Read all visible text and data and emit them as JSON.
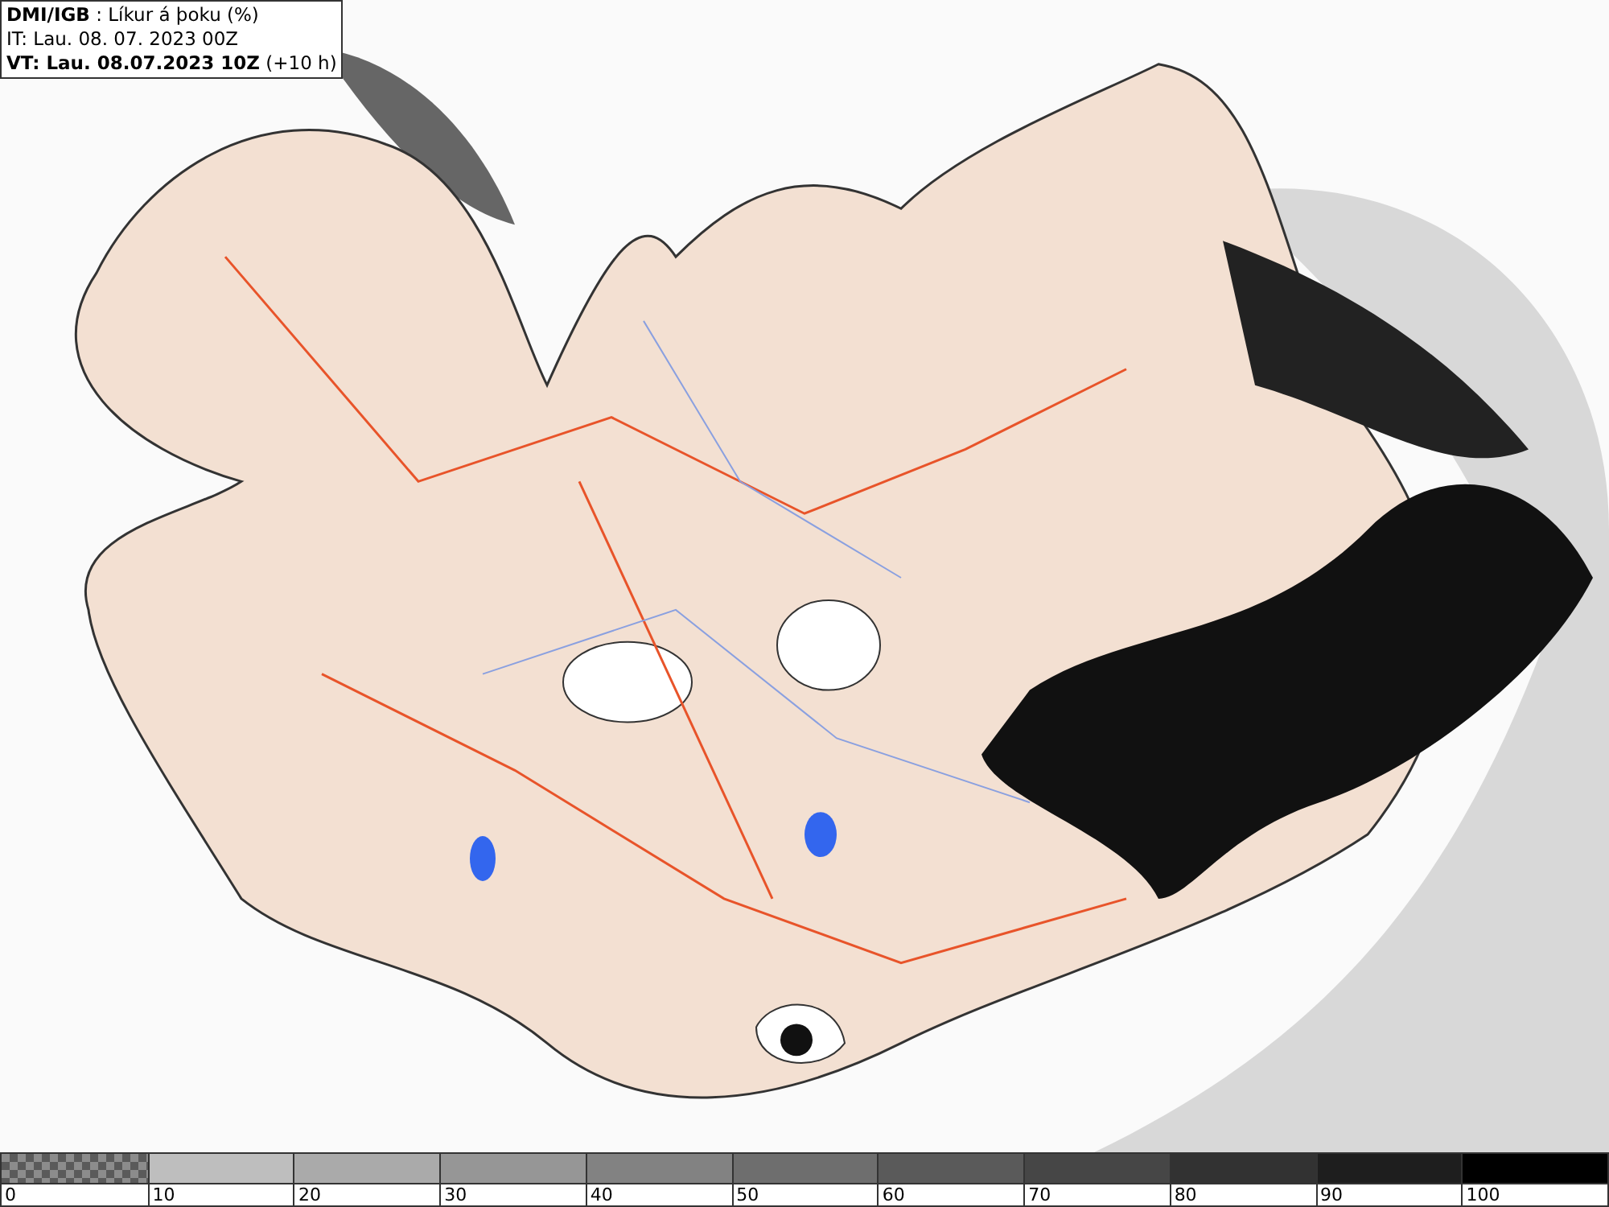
{
  "header": {
    "lines": [
      "**DMI/IGB** : Líkur á þoku (%)",
      "IT: Lau. 08. 07. 2023 00Z",
      "**VT: Lau. 08.07.2023 10Z** (+10 h)"
    ]
  },
  "legend": {
    "segments": [
      {
        "kind": "checker",
        "color": "#8c8c8c",
        "label": "0"
      },
      {
        "kind": "solid",
        "color": "#bebebe",
        "label": "10"
      },
      {
        "kind": "solid",
        "color": "#aaaaaa",
        "label": "20"
      },
      {
        "kind": "solid",
        "color": "#969696",
        "label": "30"
      },
      {
        "kind": "solid",
        "color": "#828282",
        "label": "40"
      },
      {
        "kind": "solid",
        "color": "#6e6e6e",
        "label": "50"
      },
      {
        "kind": "solid",
        "color": "#5a5a5a",
        "label": "60"
      },
      {
        "kind": "solid",
        "color": "#464646",
        "label": "70"
      },
      {
        "kind": "solid",
        "color": "#323232",
        "label": "80"
      },
      {
        "kind": "solid",
        "color": "#1e1e1e",
        "label": "90"
      },
      {
        "kind": "solid",
        "color": "#000000",
        "label": "100"
      }
    ]
  }
}
